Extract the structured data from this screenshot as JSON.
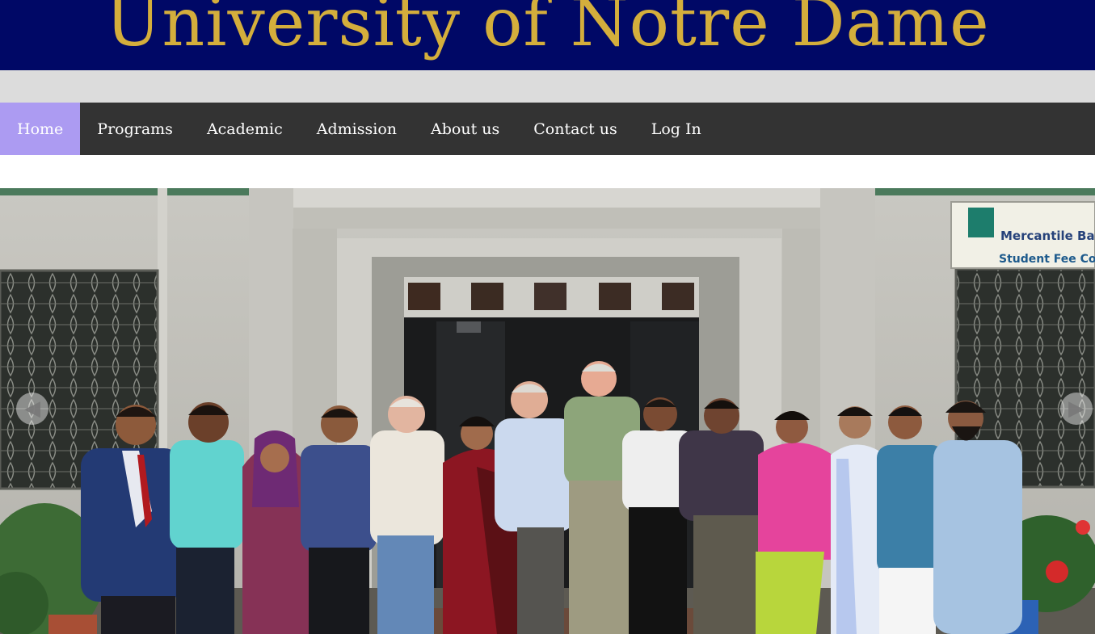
{
  "header": {
    "title": "University of Notre Dame"
  },
  "nav": {
    "items": [
      {
        "label": "Home",
        "active": true
      },
      {
        "label": "Programs"
      },
      {
        "label": "Academic"
      },
      {
        "label": "Admission"
      },
      {
        "label": "About us"
      },
      {
        "label": "Contact us"
      },
      {
        "label": "Log In"
      }
    ]
  },
  "slider": {
    "sign": {
      "line1": "Mercantile Ba",
      "line2": "Student Fee Co"
    },
    "prev_icon": "arrow-left-icon",
    "next_icon": "arrow-right-icon"
  },
  "colors": {
    "banner": "#000866",
    "banner_text": "#d4ae3c",
    "nav_bg": "#333333",
    "nav_active": "#ac9bf2"
  }
}
